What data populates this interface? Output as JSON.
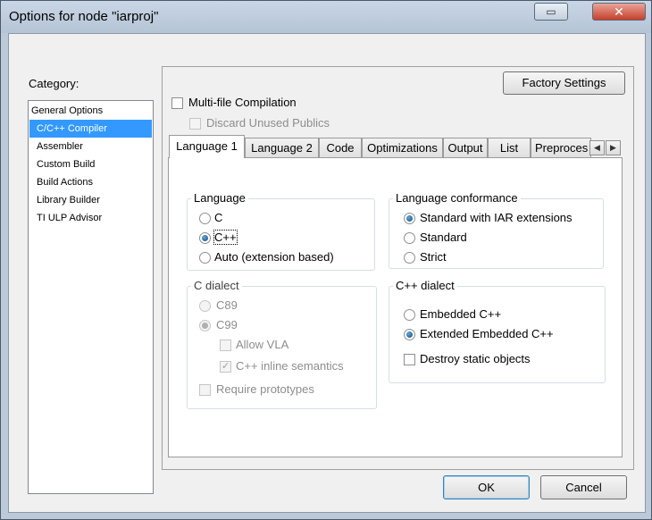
{
  "window": {
    "title": "Options for node \"iarproj\"",
    "close_glyph": "✕",
    "restore_glyph": "▭"
  },
  "category": {
    "label": "Category:",
    "items": [
      {
        "label": "General Options"
      },
      {
        "label": "C/C++ Compiler"
      },
      {
        "label": "Assembler"
      },
      {
        "label": "Custom Build"
      },
      {
        "label": "Build Actions"
      },
      {
        "label": "Library Builder"
      },
      {
        "label": "TI ULP Advisor"
      }
    ]
  },
  "factory_settings_label": "Factory Settings",
  "multi_file": {
    "label": "Multi-file Compilation",
    "checked": false
  },
  "discard_unused": {
    "label": "Discard Unused Publics",
    "checked": false,
    "disabled": true
  },
  "tabs": [
    {
      "label": "Language 1"
    },
    {
      "label": "Language 2"
    },
    {
      "label": "Code"
    },
    {
      "label": "Optimizations"
    },
    {
      "label": "Output"
    },
    {
      "label": "List"
    },
    {
      "label": "Preproces"
    }
  ],
  "scroll_glyphs": {
    "left": "◀",
    "right": "▶"
  },
  "language_group": {
    "title": "Language",
    "options": [
      {
        "label": "C",
        "selected": false
      },
      {
        "label": "C++",
        "selected": true
      },
      {
        "label": "Auto (extension based)",
        "selected": false
      }
    ]
  },
  "conformance_group": {
    "title": "Language conformance",
    "options": [
      {
        "label": "Standard with IAR extensions",
        "selected": true
      },
      {
        "label": "Standard",
        "selected": false
      },
      {
        "label": "Strict",
        "selected": false
      }
    ]
  },
  "c_dialect_group": {
    "title": "C dialect",
    "options": [
      {
        "label": "C89",
        "selected": false
      },
      {
        "label": "C99",
        "selected": true
      }
    ],
    "allow_vla": {
      "label": "Allow VLA",
      "checked": false
    },
    "inline_semantics": {
      "label": "C++ inline semantics",
      "checked": true
    },
    "require_prototypes": {
      "label": "Require prototypes",
      "checked": false
    }
  },
  "cpp_dialect_group": {
    "title": "C++ dialect",
    "options": [
      {
        "label": "Embedded C++",
        "selected": false
      },
      {
        "label": "Extended Embedded C++",
        "selected": true
      }
    ],
    "destroy_static": {
      "label": "Destroy static objects",
      "checked": false
    }
  },
  "ok_label": "OK",
  "cancel_label": "Cancel",
  "check_glyph": "✓"
}
